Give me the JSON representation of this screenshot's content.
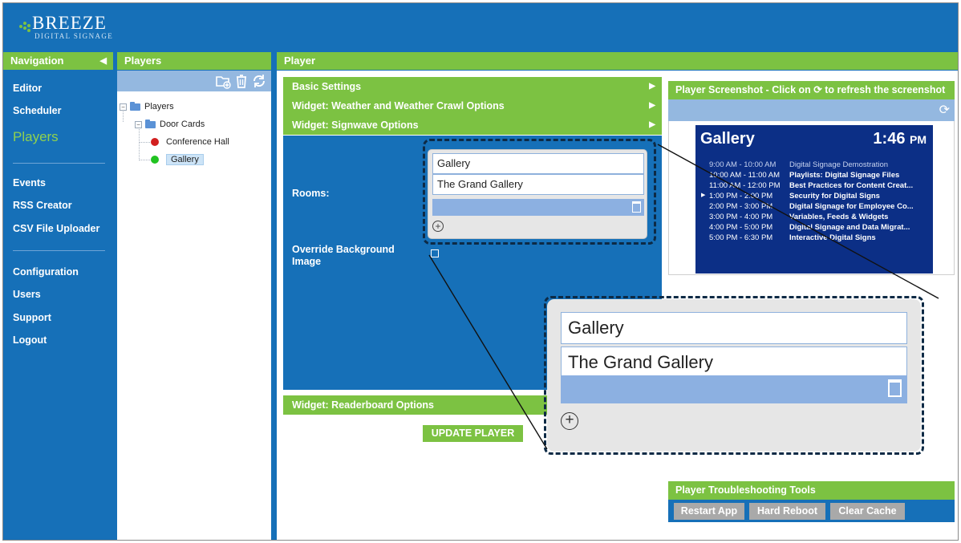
{
  "logo": {
    "word": "BREEZE",
    "tagline": "DIGITAL SIGNAGE"
  },
  "nav": {
    "header": "Navigation",
    "collapse_glyph": "◀",
    "items": [
      "Editor",
      "Scheduler",
      "Players",
      "Events",
      "RSS Creator",
      "CSV File Uploader",
      "Configuration",
      "Users",
      "Support",
      "Logout"
    ],
    "active": "Players"
  },
  "players_panel": {
    "header": "Players",
    "toolbar_icons": [
      "add-folder-icon",
      "trash-icon",
      "refresh-icon"
    ],
    "tree": {
      "root": "Players",
      "folder": "Door Cards",
      "players": [
        {
          "name": "Conference Hall",
          "status_color": "#d21f1f"
        },
        {
          "name": "Gallery",
          "status_color": "#21c321"
        }
      ],
      "selected": "Gallery"
    }
  },
  "player_panel": {
    "header": "Player",
    "sections": [
      "Basic Settings",
      "Widget: Weather and Weather Crawl Options",
      "Widget: Signwave Options",
      "Widget: Readerboard Options"
    ],
    "section_arrow": "▶",
    "rooms_label": "Rooms:",
    "rooms": [
      "Gallery",
      "The Grand Gallery"
    ],
    "override_label": "Override Background Image",
    "plus_glyph": "+",
    "update_button": "UPDATE PLAYER"
  },
  "screenshot": {
    "header": "Player Screenshot - Click on",
    "header_icon": "refresh-icon",
    "header_suffix": "to refresh the screenshot",
    "refresh_glyph": "⟳",
    "sign": {
      "title": "Gallery",
      "time": "1:46",
      "time_suffix": "PM",
      "schedule": [
        {
          "time": "9:00 AM - 10:00 AM",
          "event": "Digital Signage Demostration"
        },
        {
          "time": "10:00 AM - 11:00 AM",
          "event": "Playlists: Digital Signage Files"
        },
        {
          "time": "11:00 AM - 12:00 PM",
          "event": "Best Practices for Content Creat..."
        },
        {
          "time": "1:00 PM - 2:00 PM",
          "event": "Security for Digital Signs"
        },
        {
          "time": "2:00 PM - 3:00 PM",
          "event": "Digital Signage for Employee Co..."
        },
        {
          "time": "3:00 PM - 4:00 PM",
          "event": "Variables, Feeds & Widgets"
        },
        {
          "time": "4:00 PM - 5:00 PM",
          "event": "Digital Signage and Data Migrat..."
        },
        {
          "time": "5:00 PM - 6:30 PM",
          "event": "Interactive Digital Signs"
        }
      ],
      "pointer_glyph": "▶"
    }
  },
  "zoom": {
    "rooms": [
      "Gallery",
      "The Grand Gallery"
    ],
    "plus_glyph": "+"
  },
  "troubleshooting": {
    "header": "Player Troubleshooting Tools",
    "buttons": [
      "Restart App",
      "Hard Reboot",
      "Clear Cache"
    ]
  },
  "colors": {
    "brand_blue": "#1670b8",
    "brand_green": "#7cc242",
    "toolbar_blue": "#94b8e0",
    "sign_blue": "#0c2f86"
  }
}
